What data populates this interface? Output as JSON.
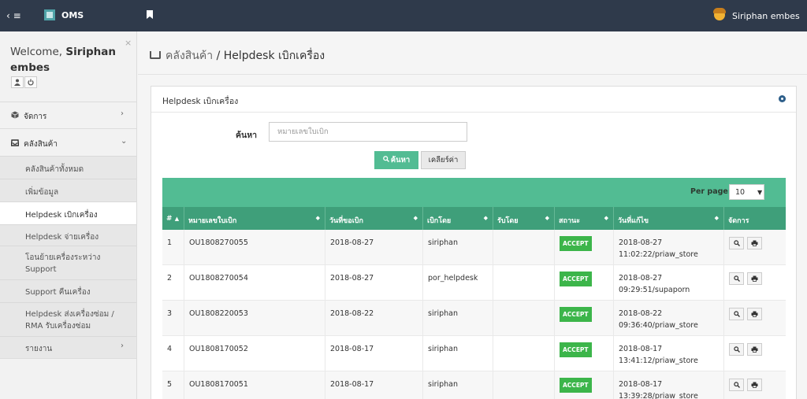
{
  "topbar": {
    "toggle_icon": "‹ ≡",
    "brand": "OMS",
    "user_name": "Siriphan embes"
  },
  "sidebar": {
    "close_icon": "×",
    "welcome_prefix": "Welcome,",
    "welcome_name_line1": "Siriphan",
    "welcome_name_line2": "embes",
    "menu": [
      {
        "label": "จัดการ",
        "icon": "cube-icon",
        "arrow": "›"
      },
      {
        "label": "คลังสินค้า",
        "icon": "inbox-icon",
        "arrow": "⌄"
      }
    ],
    "sub_items": [
      {
        "label": "คลังสินค้าทั้งหมด"
      },
      {
        "label": "เพิ่มข้อมูล"
      },
      {
        "label": "Helpdesk เบิกเครื่อง"
      },
      {
        "label": "Helpdesk จ่ายเครื่อง"
      },
      {
        "label_line1": "โอนย้ายเครื่องระหว่าง",
        "label_line2": "Support"
      },
      {
        "label": "Support คืนเครื่อง"
      },
      {
        "label_line1": "Helpdesk ส่งเครื่องซ่อม /",
        "label_line2": "RMA รับเครื่องซ่อม"
      },
      {
        "label": "รายงาน",
        "arrow": "›"
      }
    ]
  },
  "page": {
    "crumb": "คลังสินค้า",
    "separator": " / ",
    "title": "Helpdesk เบิกเครื่อง"
  },
  "panel": {
    "title": "Helpdesk เบิกเครื่อง",
    "search": {
      "label": "ค้นหา",
      "placeholder": "หมายเลขใบเบิก",
      "value": "",
      "search_button": "ค้นหา",
      "clear_button": "เคลียร์ค่า"
    },
    "per_page_label": "Per page:",
    "per_page_value": "10",
    "columns": [
      "#",
      "หมายเลขใบเบิก",
      "วันที่ขอเบิก",
      "เบิกโดย",
      "รับโดย",
      "สถานะ",
      "วันที่แก้ไข",
      "จัดการ"
    ],
    "rows": [
      {
        "no": "1",
        "doc": "OU1808270055",
        "date": "2018-08-27",
        "by": "siriphan",
        "recv": "",
        "status": "ACCEPT",
        "mod_date": "2018-08-27",
        "mod_detail": "11:02:22/priaw_store"
      },
      {
        "no": "2",
        "doc": "OU1808270054",
        "date": "2018-08-27",
        "by": "por_helpdesk",
        "recv": "",
        "status": "ACCEPT",
        "mod_date": "2018-08-27",
        "mod_detail": "09:29:51/supaporn"
      },
      {
        "no": "3",
        "doc": "OU1808220053",
        "date": "2018-08-22",
        "by": "siriphan",
        "recv": "",
        "status": "ACCEPT",
        "mod_date": "2018-08-22",
        "mod_detail": "09:36:40/priaw_store"
      },
      {
        "no": "4",
        "doc": "OU1808170052",
        "date": "2018-08-17",
        "by": "siriphan",
        "recv": "",
        "status": "ACCEPT",
        "mod_date": "2018-08-17",
        "mod_detail": "13:41:12/priaw_store"
      },
      {
        "no": "5",
        "doc": "OU1808170051",
        "date": "2018-08-17",
        "by": "siriphan",
        "recv": "",
        "status": "ACCEPT",
        "mod_date": "2018-08-17",
        "mod_detail": "13:39:28/priaw_store"
      }
    ]
  },
  "colors": {
    "topbar": "#2f3a4b",
    "accent": "#52bc93",
    "table_header": "#3f9f7a",
    "badge": "#3cb54a"
  }
}
